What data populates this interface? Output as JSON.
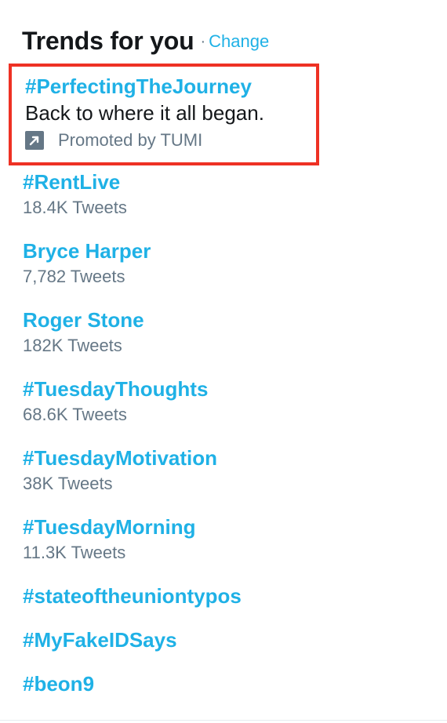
{
  "header": {
    "title": "Trends for you",
    "separator": "·",
    "change_label": "Change"
  },
  "promoted_trend": {
    "name": "#PerfectingTheJourney",
    "description": "Back to where it all began.",
    "promoted_text": "Promoted by TUMI",
    "icon": "promoted-arrow-icon"
  },
  "trends": [
    {
      "name": "#RentLive",
      "count": "18.4K Tweets"
    },
    {
      "name": "Bryce Harper",
      "count": "7,782 Tweets"
    },
    {
      "name": "Roger Stone",
      "count": "182K Tweets"
    },
    {
      "name": "#TuesdayThoughts",
      "count": "68.6K Tweets"
    },
    {
      "name": "#TuesdayMotivation",
      "count": "38K Tweets"
    },
    {
      "name": "#TuesdayMorning",
      "count": "11.3K Tweets"
    },
    {
      "name": "#stateoftheuniontypos"
    },
    {
      "name": "#MyFakeIDSays"
    },
    {
      "name": "#beon9"
    }
  ],
  "colors": {
    "link": "#1fb1e6",
    "text": "#14171a",
    "muted": "#657786",
    "highlight_border": "#ee3124"
  }
}
